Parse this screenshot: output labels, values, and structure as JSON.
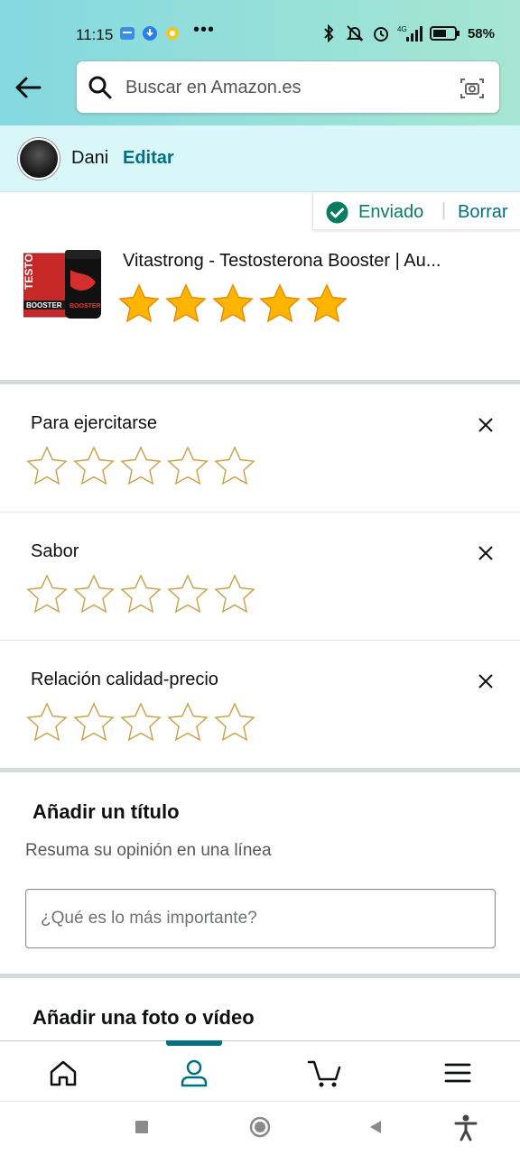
{
  "status_bar": {
    "time": "11:15",
    "dots": "•••",
    "battery": "58%"
  },
  "search": {
    "placeholder": "Buscar en Amazon.es"
  },
  "user": {
    "name": "Dani",
    "edit_label": "Editar"
  },
  "review_status": {
    "sent_label": "Enviado",
    "separator": "|",
    "delete_label": "Borrar"
  },
  "product": {
    "title": "Vitastrong - Testosterona Booster | Au...",
    "rating": 5,
    "max_rating": 5,
    "image_text": "TESTO BOOSTER"
  },
  "attributes": [
    {
      "label": "Para ejercitarse",
      "rating": 0
    },
    {
      "label": "Sabor",
      "rating": 0
    },
    {
      "label": "Relación calidad-precio",
      "rating": 0
    }
  ],
  "title_section": {
    "heading": "Añadir un título",
    "hint": "Resuma su opinión en una línea",
    "placeholder": "¿Qué es lo más importante?",
    "value": ""
  },
  "photo_section": {
    "heading": "Añadir una foto o vídeo"
  },
  "bottom_nav": {
    "items": [
      "home-icon",
      "account-icon",
      "cart-icon",
      "menu-icon"
    ],
    "active": "account-icon"
  },
  "colors": {
    "accent": "#007185",
    "star_fill": "#ffa41c",
    "star_outline": "#c9a14a",
    "success": "#067d62"
  }
}
